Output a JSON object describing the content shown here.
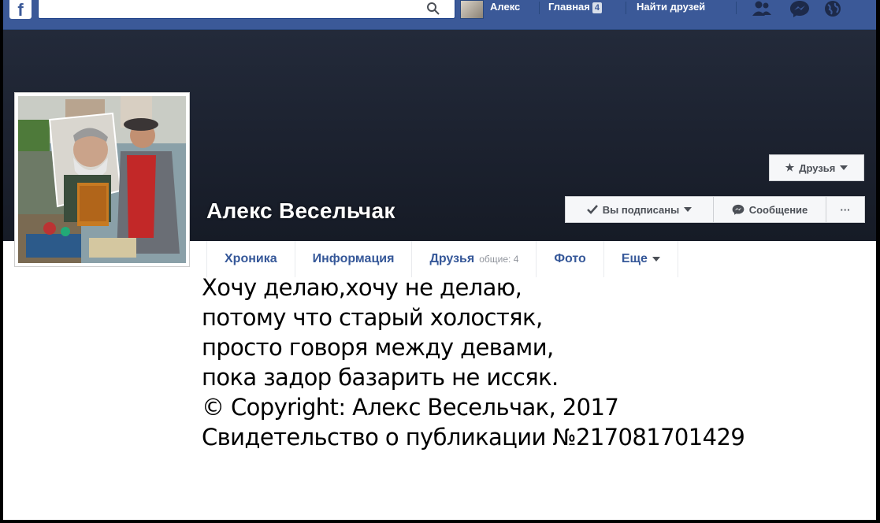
{
  "topbar": {
    "logo": "f",
    "search_placeholder": "",
    "user_name": "Алекс",
    "home_label": "Главная",
    "home_count": "4",
    "find_friends_label": "Найти друзей",
    "icons": [
      "search-icon",
      "friend-requests-icon",
      "messenger-icon",
      "notifications-globe-icon"
    ]
  },
  "profile": {
    "name": "Алекс Весельчак",
    "friends_button": "Друзья",
    "following_button": "Вы подписаны",
    "message_button": "Сообщение",
    "more_button": "···"
  },
  "tabs": [
    {
      "label": "Хроника"
    },
    {
      "label": "Информация"
    },
    {
      "label": "Друзья",
      "sub": "общие: 4"
    },
    {
      "label": "Фото"
    },
    {
      "label": "Еще"
    }
  ],
  "poem": [
    "Хочу делаю,хочу не делаю,",
    "потому что старый холостяк,",
    "просто говоря между девами,",
    "пока задор базарить не иссяк.",
    "© Copyright: Алекс Весельчак, 2017",
    "Свидетельство о публикации №217081701429"
  ],
  "colors": {
    "facebook_blue": "#3b5998",
    "link_blue": "#365899",
    "cover_dark": "#1d2331"
  }
}
